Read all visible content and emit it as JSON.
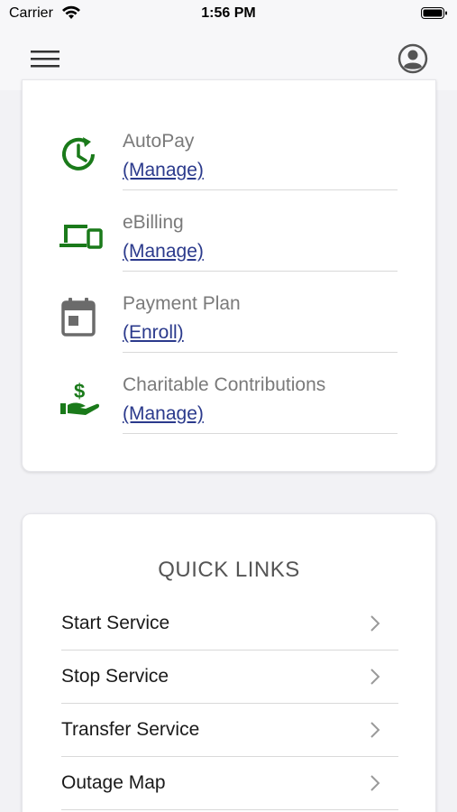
{
  "status": {
    "carrier": "Carrier",
    "time": "1:56 PM"
  },
  "options": [
    {
      "title": "AutoPay",
      "link": "(Manage)",
      "icon": "autopay-clock-icon"
    },
    {
      "title": "eBilling",
      "link": "(Manage)",
      "icon": "devices-icon"
    },
    {
      "title": "Payment Plan",
      "link": "(Enroll)",
      "icon": "calendar-icon"
    },
    {
      "title": "Charitable Contributions",
      "link": "(Manage)",
      "icon": "hand-dollar-icon"
    }
  ],
  "quick_links": {
    "title": "QUICK LINKS",
    "items": [
      "Start Service",
      "Stop Service",
      "Transfer Service",
      "Outage Map"
    ]
  },
  "colors": {
    "green": "#1a7a1a",
    "gray_icon": "#6b6b6b",
    "link": "#2b3a8c"
  }
}
